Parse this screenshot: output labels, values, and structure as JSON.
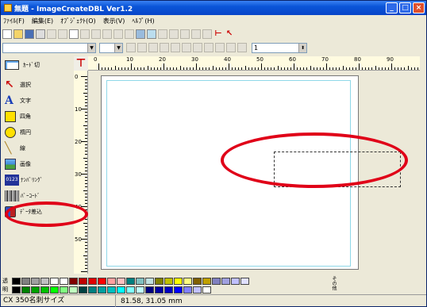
{
  "window": {
    "title": "無題 - ImageCreateDBL Ver1.2",
    "controls": [
      "_",
      "□",
      "×"
    ]
  },
  "menubar": {
    "items": [
      "ﾌｧｲﾙ(F)",
      "編集(E)",
      "ｵﾌﾞｼﾞｪｸﾄ(O)",
      "表示(V)",
      "ﾍﾙﾌﾟ(H)"
    ]
  },
  "toolbar2": {
    "size_value": "1"
  },
  "tools": {
    "card": "ｶｰﾄﾞ切",
    "items": [
      {
        "label": "選択",
        "icon": "arrow-select-icon",
        "color": "#cc1111"
      },
      {
        "label": "文字",
        "icon": "text-a-icon",
        "color": "#1a3fb8"
      },
      {
        "label": "四角",
        "icon": "rectangle-icon",
        "color": "#ffe000"
      },
      {
        "label": "楕円",
        "icon": "ellipse-icon",
        "color": "#ffe000"
      },
      {
        "label": "線",
        "icon": "line-icon",
        "color": "#c8a040"
      },
      {
        "label": "画像",
        "icon": "image-icon",
        "color": "#3c8ad8"
      },
      {
        "label": "ﾅﾝﾊﾞﾘﾝｸﾞ",
        "icon": "numbering-icon",
        "color": "#223399",
        "badge": "0123"
      },
      {
        "label": "ﾊﾞｰｺｰﾄﾞ",
        "icon": "barcode-icon",
        "color": "#555555"
      },
      {
        "label": "ﾃﾞｰﾀ差込",
        "icon": "data-insert-icon",
        "color": "#bb2222"
      }
    ]
  },
  "rulers": {
    "horizontal": [
      "0",
      "10",
      "20",
      "30",
      "40",
      "50",
      "60",
      "70",
      "80",
      "90"
    ],
    "vertical": [
      "0",
      "10",
      "20",
      "30",
      "40",
      "50"
    ]
  },
  "palette": {
    "row1_label": "透",
    "row2_label": "明",
    "more_label": "その他",
    "row1": [
      "#000000",
      "#808080",
      "#a0a0a0",
      "#c0c0c0",
      "#ffffff",
      "#ffffff",
      "#800000",
      "#c00000",
      "#e00000",
      "#ff0000",
      "#ffa0a0",
      "#ffc0c0",
      "#008080",
      "#80c0c0",
      "#c0e0e0",
      "#808000",
      "#c0c000",
      "#ffff00",
      "#ffff80",
      "#806000",
      "#c0a000",
      "#8080c0",
      "#a0a0e0",
      "#c0c0ff",
      "#e0e0ff"
    ],
    "row2": [
      "#000000",
      "#008000",
      "#00a000",
      "#00c000",
      "#00ff00",
      "#80ff80",
      "#c0ffc0",
      "#004040",
      "#008080",
      "#00a0a0",
      "#00c0c0",
      "#00ffff",
      "#80ffff",
      "#c0ffff",
      "#000080",
      "#0000a0",
      "#0000c0",
      "#0000ff",
      "#8080ff",
      "#c0c0ff",
      "#ffffff"
    ]
  },
  "status": {
    "card_size": "CX 350名刺サイズ",
    "position": "81.58, 31.05 mm"
  },
  "highlight_color": "#e00018"
}
